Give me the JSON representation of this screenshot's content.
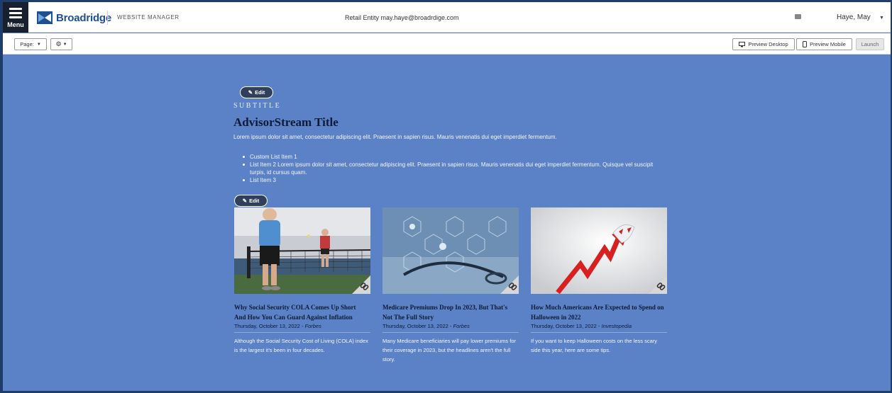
{
  "header": {
    "menu_label": "Menu",
    "brand_name": "Broadridge",
    "product_name": "WEBSITE MANAGER",
    "entity_text": "Retail Entity  may.haye@broadrdige.com",
    "user_name": "Haye, May"
  },
  "toolbar": {
    "page_label": "Page:",
    "preview_desktop_label": "Preview Desktop",
    "preview_mobile_label": "Preview Mobile",
    "launch_label": "Launch"
  },
  "hero": {
    "edit_label": "Edit",
    "subtitle": "SUBTITLE",
    "title": "AdvisorStream Title",
    "intro": "Lorem ipsum dolor sit amet, consectetur adipiscing elit. Praesent in sapien risus. Mauris venenatis dui eget imperdiet fermentum.",
    "list_items": [
      "Custom List Item 1",
      "List Item 2 Lorem ipsum dolor sit amet, consectetur adipiscing elit. Praesent in sapien risus. Mauris venenatis dui eget imperdiet fermentum. Quisque vel suscipit turpis, id cursus quam.",
      "List Item 3"
    ]
  },
  "articles_edit_label": "Edit",
  "articles": [
    {
      "title": "Why Social Security COLA Comes Up Short And How You Can Guard Against Inflation",
      "date": "Thursday, October 13, 2022 - ",
      "source": "Forbes",
      "summary": "Although the Social Security Cost of Living (COLA) index is the largest it's been in four decades."
    },
    {
      "title": "Medicare Premiums Drop In 2023, But That's Not The Full Story",
      "date": "Thursday, October 13, 2022 - ",
      "source": "Forbes",
      "summary": "Many Medicare beneficiaries will pay lower premiums for their coverage in 2023, but the headlines aren't the full story."
    },
    {
      "title": "How Much Americans Are Expected to Spend on Halloween in 2022",
      "date": "Thursday, October 13, 2022 - ",
      "source": "Investopedia",
      "summary": "If you want to keep Halloween costs on the less scary side this year, here are some tips."
    }
  ],
  "colors": {
    "page_background": "#5b82c6",
    "header_dark": "#17202e",
    "brand_blue": "#1d4f91",
    "edit_pill": "#2f3f5c"
  }
}
